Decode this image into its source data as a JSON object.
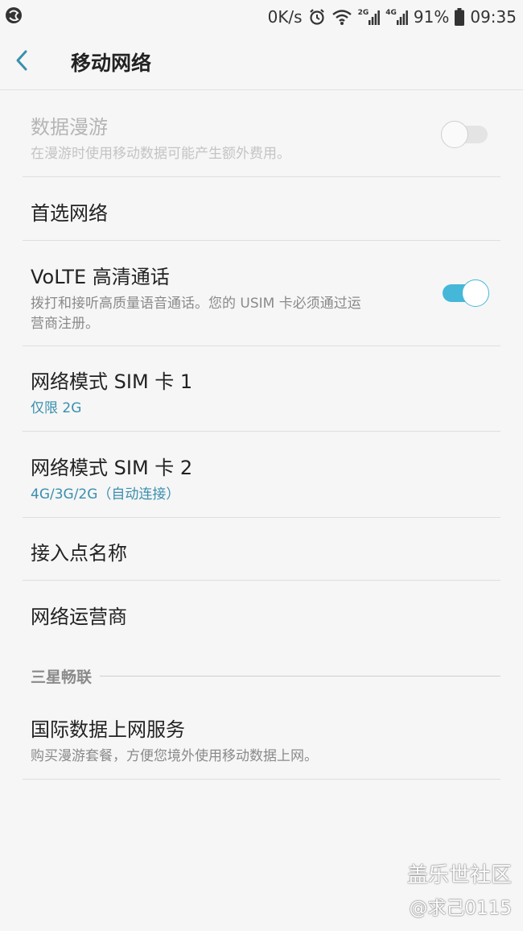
{
  "status_bar": {
    "net_speed": "0K/s",
    "sim1_label": "2G",
    "sim2_label": "4G",
    "battery": "91%",
    "time": "09:35"
  },
  "header": {
    "title": "移动网络"
  },
  "settings": {
    "data_roaming": {
      "title": "数据漫游",
      "subtitle": "在漫游时使用移动数据可能产生额外费用。",
      "enabled": false
    },
    "preferred_network": {
      "title": "首选网络"
    },
    "volte": {
      "title": "VoLTE 高清通话",
      "subtitle_line1": "拨打和接听高质量语音通话。您的 USIM 卡必须通过运",
      "subtitle_line2": "营商注册。",
      "enabled": true
    },
    "network_mode_sim1": {
      "title": "网络模式 SIM 卡 1",
      "value": "仅限 2G"
    },
    "network_mode_sim2": {
      "title": "网络模式 SIM 卡 2",
      "value": "4G/3G/2G（自动连接）"
    },
    "apn": {
      "title": "接入点名称"
    },
    "network_operator": {
      "title": "网络运营商"
    }
  },
  "samsung_section": {
    "header": "三星畅联",
    "intl_data": {
      "title": "国际数据上网服务",
      "subtitle": "购买漫游套餐，方便您境外使用移动数据上网。"
    }
  },
  "watermark": {
    "line1": "盖乐世社区",
    "line2": "@求己0115"
  },
  "colors": {
    "accent": "#45b7d9",
    "link_text": "#3a8fae"
  },
  "icons": [
    "app-notification-icon",
    "alarm-icon",
    "wifi-icon",
    "signal-icon",
    "battery-icon",
    "back-arrow-icon"
  ]
}
